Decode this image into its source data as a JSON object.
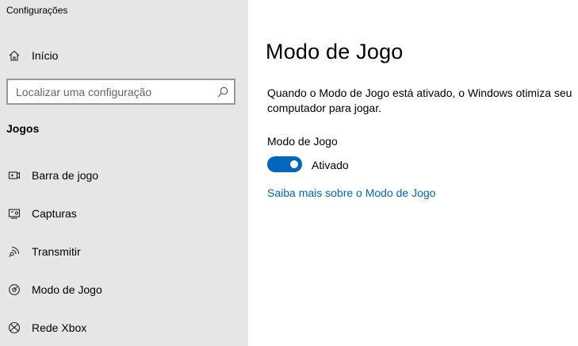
{
  "window": {
    "title": "Configurações"
  },
  "sidebar": {
    "home_label": "Início",
    "search": {
      "placeholder": "Localizar uma configuração"
    },
    "section_heading": "Jogos",
    "items": [
      {
        "label": "Barra de jogo",
        "icon": "game-bar-icon"
      },
      {
        "label": "Capturas",
        "icon": "captures-icon"
      },
      {
        "label": "Transmitir",
        "icon": "broadcast-icon"
      },
      {
        "label": "Modo de Jogo",
        "icon": "game-mode-icon"
      },
      {
        "label": "Rede Xbox",
        "icon": "xbox-icon"
      }
    ]
  },
  "main": {
    "title": "Modo de Jogo",
    "description": "Quando o Modo de Jogo está ativado, o Windows otimiza seu computador para jogar.",
    "toggle": {
      "label": "Modo de Jogo",
      "state_text": "Ativado",
      "on": true
    },
    "link_text": "Saiba mais sobre o Modo de Jogo"
  },
  "colors": {
    "accent": "#0067c0",
    "sidebar_bg": "#e6e6e6",
    "content_bg": "#ffffff"
  }
}
